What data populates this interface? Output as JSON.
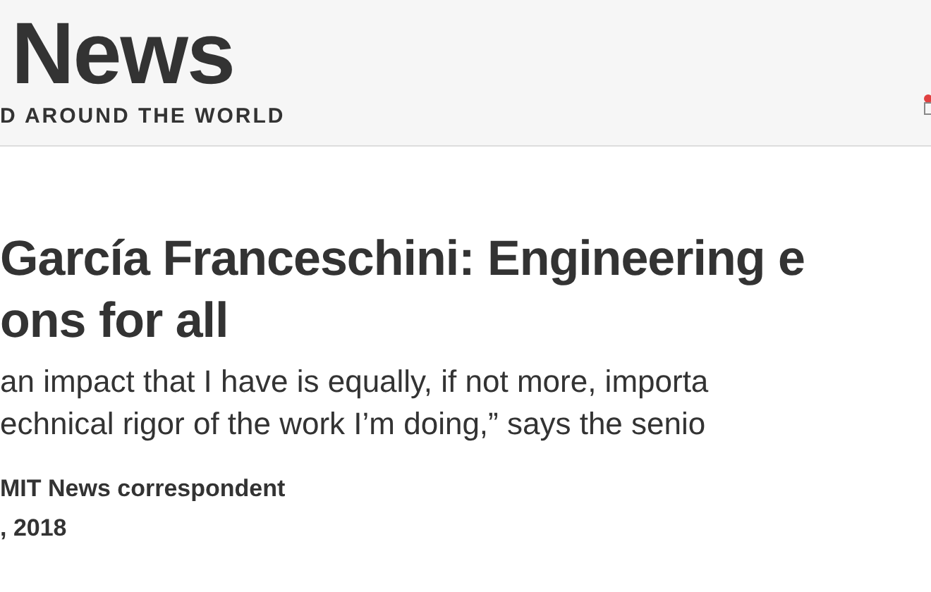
{
  "header": {
    "logo": "News",
    "tagline": "D AROUND THE WORLD"
  },
  "article": {
    "title_lines": [
      "García Franceschini: Engineering e",
      "ons for all"
    ],
    "subtitle_lines": [
      "an impact that I have is equally, if not more, importa",
      "echnical rigor of the work I’m doing,” says the senio"
    ],
    "byline": "MIT News correspondent",
    "date": ", 2018"
  }
}
